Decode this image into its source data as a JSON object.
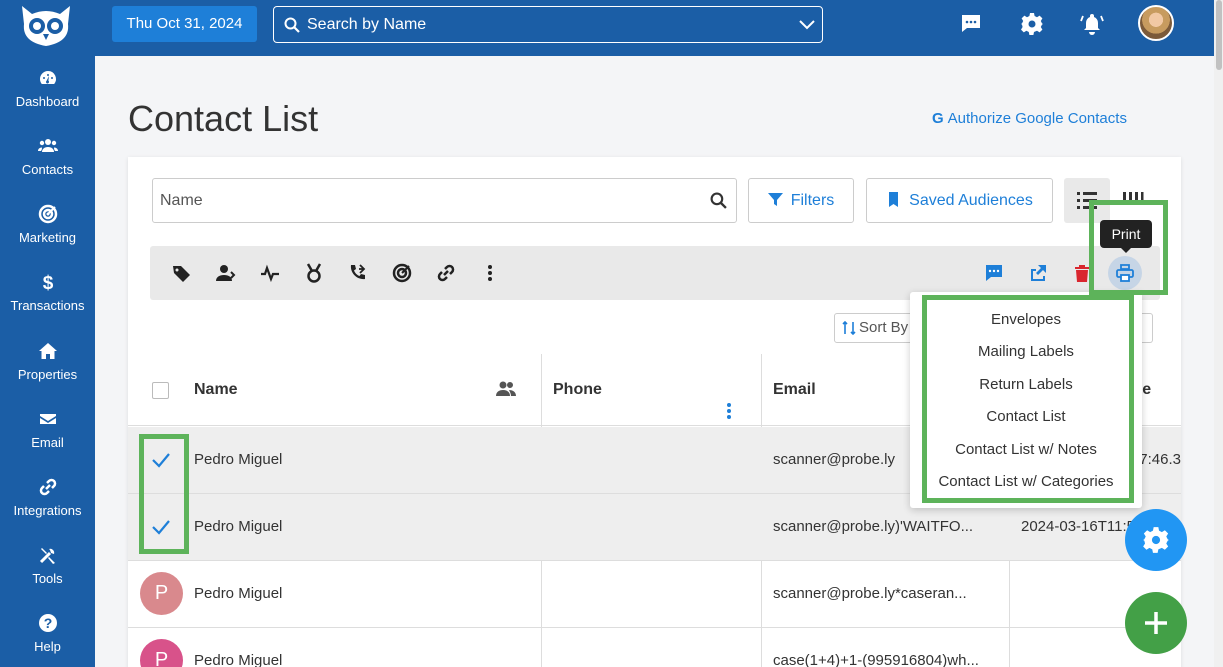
{
  "sidebar": {
    "items": [
      {
        "label": "Dashboard",
        "icon": "dashboard-icon"
      },
      {
        "label": "Contacts",
        "icon": "users-icon"
      },
      {
        "label": "Marketing",
        "icon": "bullseye-icon"
      },
      {
        "label": "Transactions",
        "icon": "dollar-icon"
      },
      {
        "label": "Properties",
        "icon": "home-icon"
      },
      {
        "label": "Email",
        "icon": "envelope-icon"
      },
      {
        "label": "Integrations",
        "icon": "link-icon"
      },
      {
        "label": "Tools",
        "icon": "tools-icon"
      },
      {
        "label": "Help",
        "icon": "question-icon"
      }
    ]
  },
  "topbar": {
    "date": "Thu Oct 31, 2024",
    "search_placeholder": "Search by Name"
  },
  "page": {
    "title": "Contact List",
    "google_link": "Authorize Google Contacts",
    "google_glyph": "G"
  },
  "controls": {
    "name_placeholder": "Name",
    "filters_label": "Filters",
    "saved_audiences_label": "Saved Audiences",
    "sort_label": "Sort By"
  },
  "tooltip": {
    "print": "Print"
  },
  "print_menu": {
    "items": [
      "Envelopes",
      "Mailing Labels",
      "Return Labels",
      "Contact List",
      "Contact List w/ Notes",
      "Contact List w/ Categories"
    ]
  },
  "table": {
    "headers": {
      "name": "Name",
      "phone": "Phone",
      "email": "Email",
      "date": "ate"
    },
    "rows": [
      {
        "name": "Pedro Miguel",
        "phone": "",
        "email": "scanner@probe.ly",
        "date": "7:46.3",
        "selected": true,
        "avatar": ""
      },
      {
        "name": "Pedro Miguel",
        "phone": "",
        "email": "scanner@probe.ly)'WAITFO...",
        "date": "2024-03-16T11:5",
        "selected": true,
        "avatar": ""
      },
      {
        "name": "Pedro Miguel",
        "phone": "",
        "email": "scanner@probe.ly*caseran...",
        "date": "",
        "selected": false,
        "avatar": "P"
      },
      {
        "name": "Pedro Miguel",
        "phone": "",
        "email": "case(1+4)+1-(995916804)wh...",
        "date": "",
        "selected": false,
        "avatar": "P"
      }
    ]
  },
  "colors": {
    "primary": "#1b5ea6",
    "accent": "#1e7fd8",
    "highlight": "#5db35a",
    "delete": "#d9262e",
    "fab_settings": "#2196f3",
    "fab_add": "#43a047"
  }
}
